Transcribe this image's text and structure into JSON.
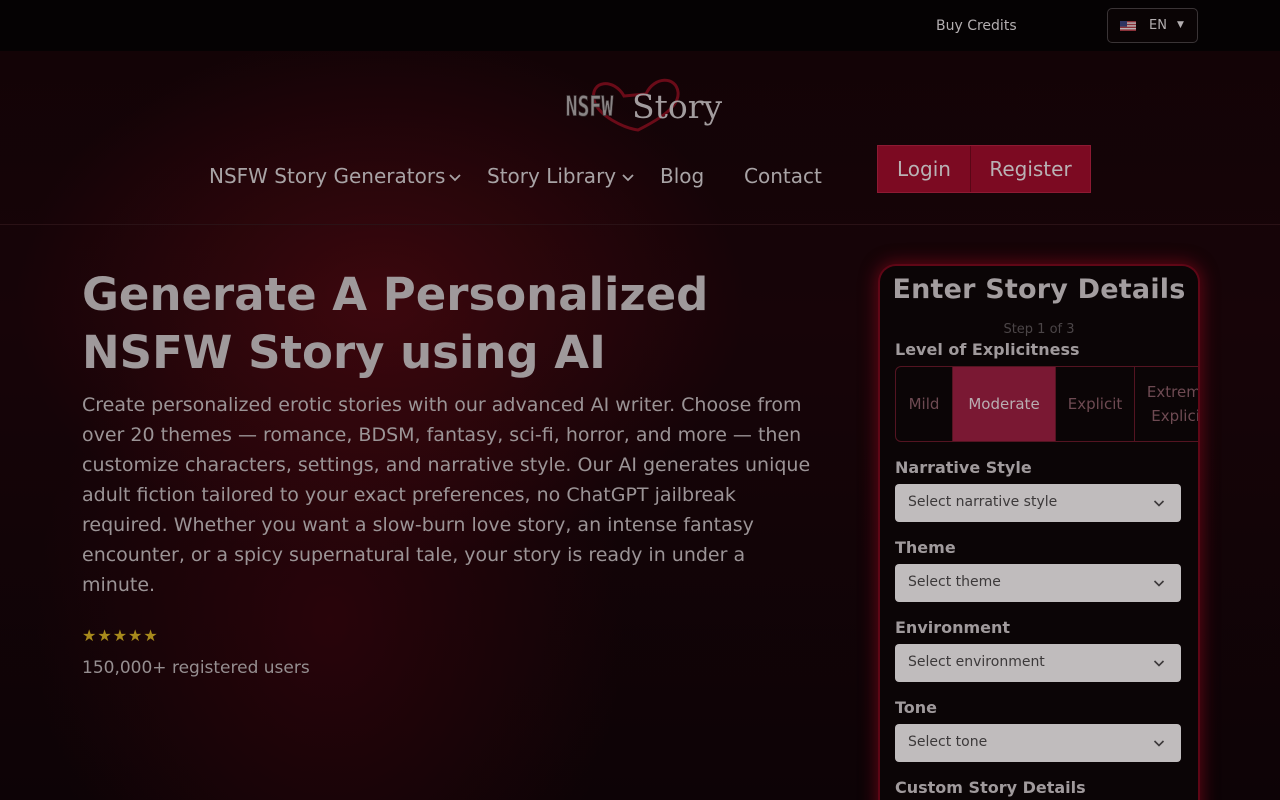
{
  "topbar": {
    "buy_credits": "Buy Credits",
    "language": "EN",
    "flag_icon": "us-flag-icon"
  },
  "header": {
    "logo_text": "NSFW Story",
    "nav": [
      {
        "label": "NSFW Story Generators",
        "has_dropdown": true
      },
      {
        "label": "Story Library",
        "has_dropdown": true
      },
      {
        "label": "Blog",
        "has_dropdown": false
      },
      {
        "label": "Contact",
        "has_dropdown": false
      }
    ],
    "login": "Login",
    "register": "Register"
  },
  "hero": {
    "title_line1": "Generate A Personalized",
    "title_line2": "NSFW Story using AI",
    "description": "Create personalized erotic stories with our advanced AI writer. Choose from over 20 themes — romance, BDSM, fantasy, sci-fi, horror, and more — then customize characters, settings, and narrative style. Our AI generates unique adult fiction tailored to your exact preferences, no ChatGPT jailbreak required. Whether you want a slow-burn love story, an intense fantasy encounter, or a spicy supernatural tale, your story is ready in under a minute.",
    "rating_stars": 5,
    "users": "150,000+ registered users"
  },
  "form": {
    "title": "Enter Story Details",
    "step": "Step 1 of 3",
    "explicitness_label": "Level of Explicitness",
    "explicitness_options": [
      "Mild",
      "Moderate",
      "Explicit",
      "Extreme Explicit"
    ],
    "explicitness_selected": "Moderate",
    "narrative_label": "Narrative Style",
    "narrative_placeholder": "Select narrative style",
    "theme_label": "Theme",
    "theme_placeholder": "Select theme",
    "environment_label": "Environment",
    "environment_placeholder": "Select environment",
    "tone_label": "Tone",
    "tone_placeholder": "Select tone",
    "custom_label": "Custom Story Details"
  },
  "colors": {
    "accent": "#7c0a22",
    "segment_selected": "#7a1833",
    "stars": "#a88a1c"
  }
}
